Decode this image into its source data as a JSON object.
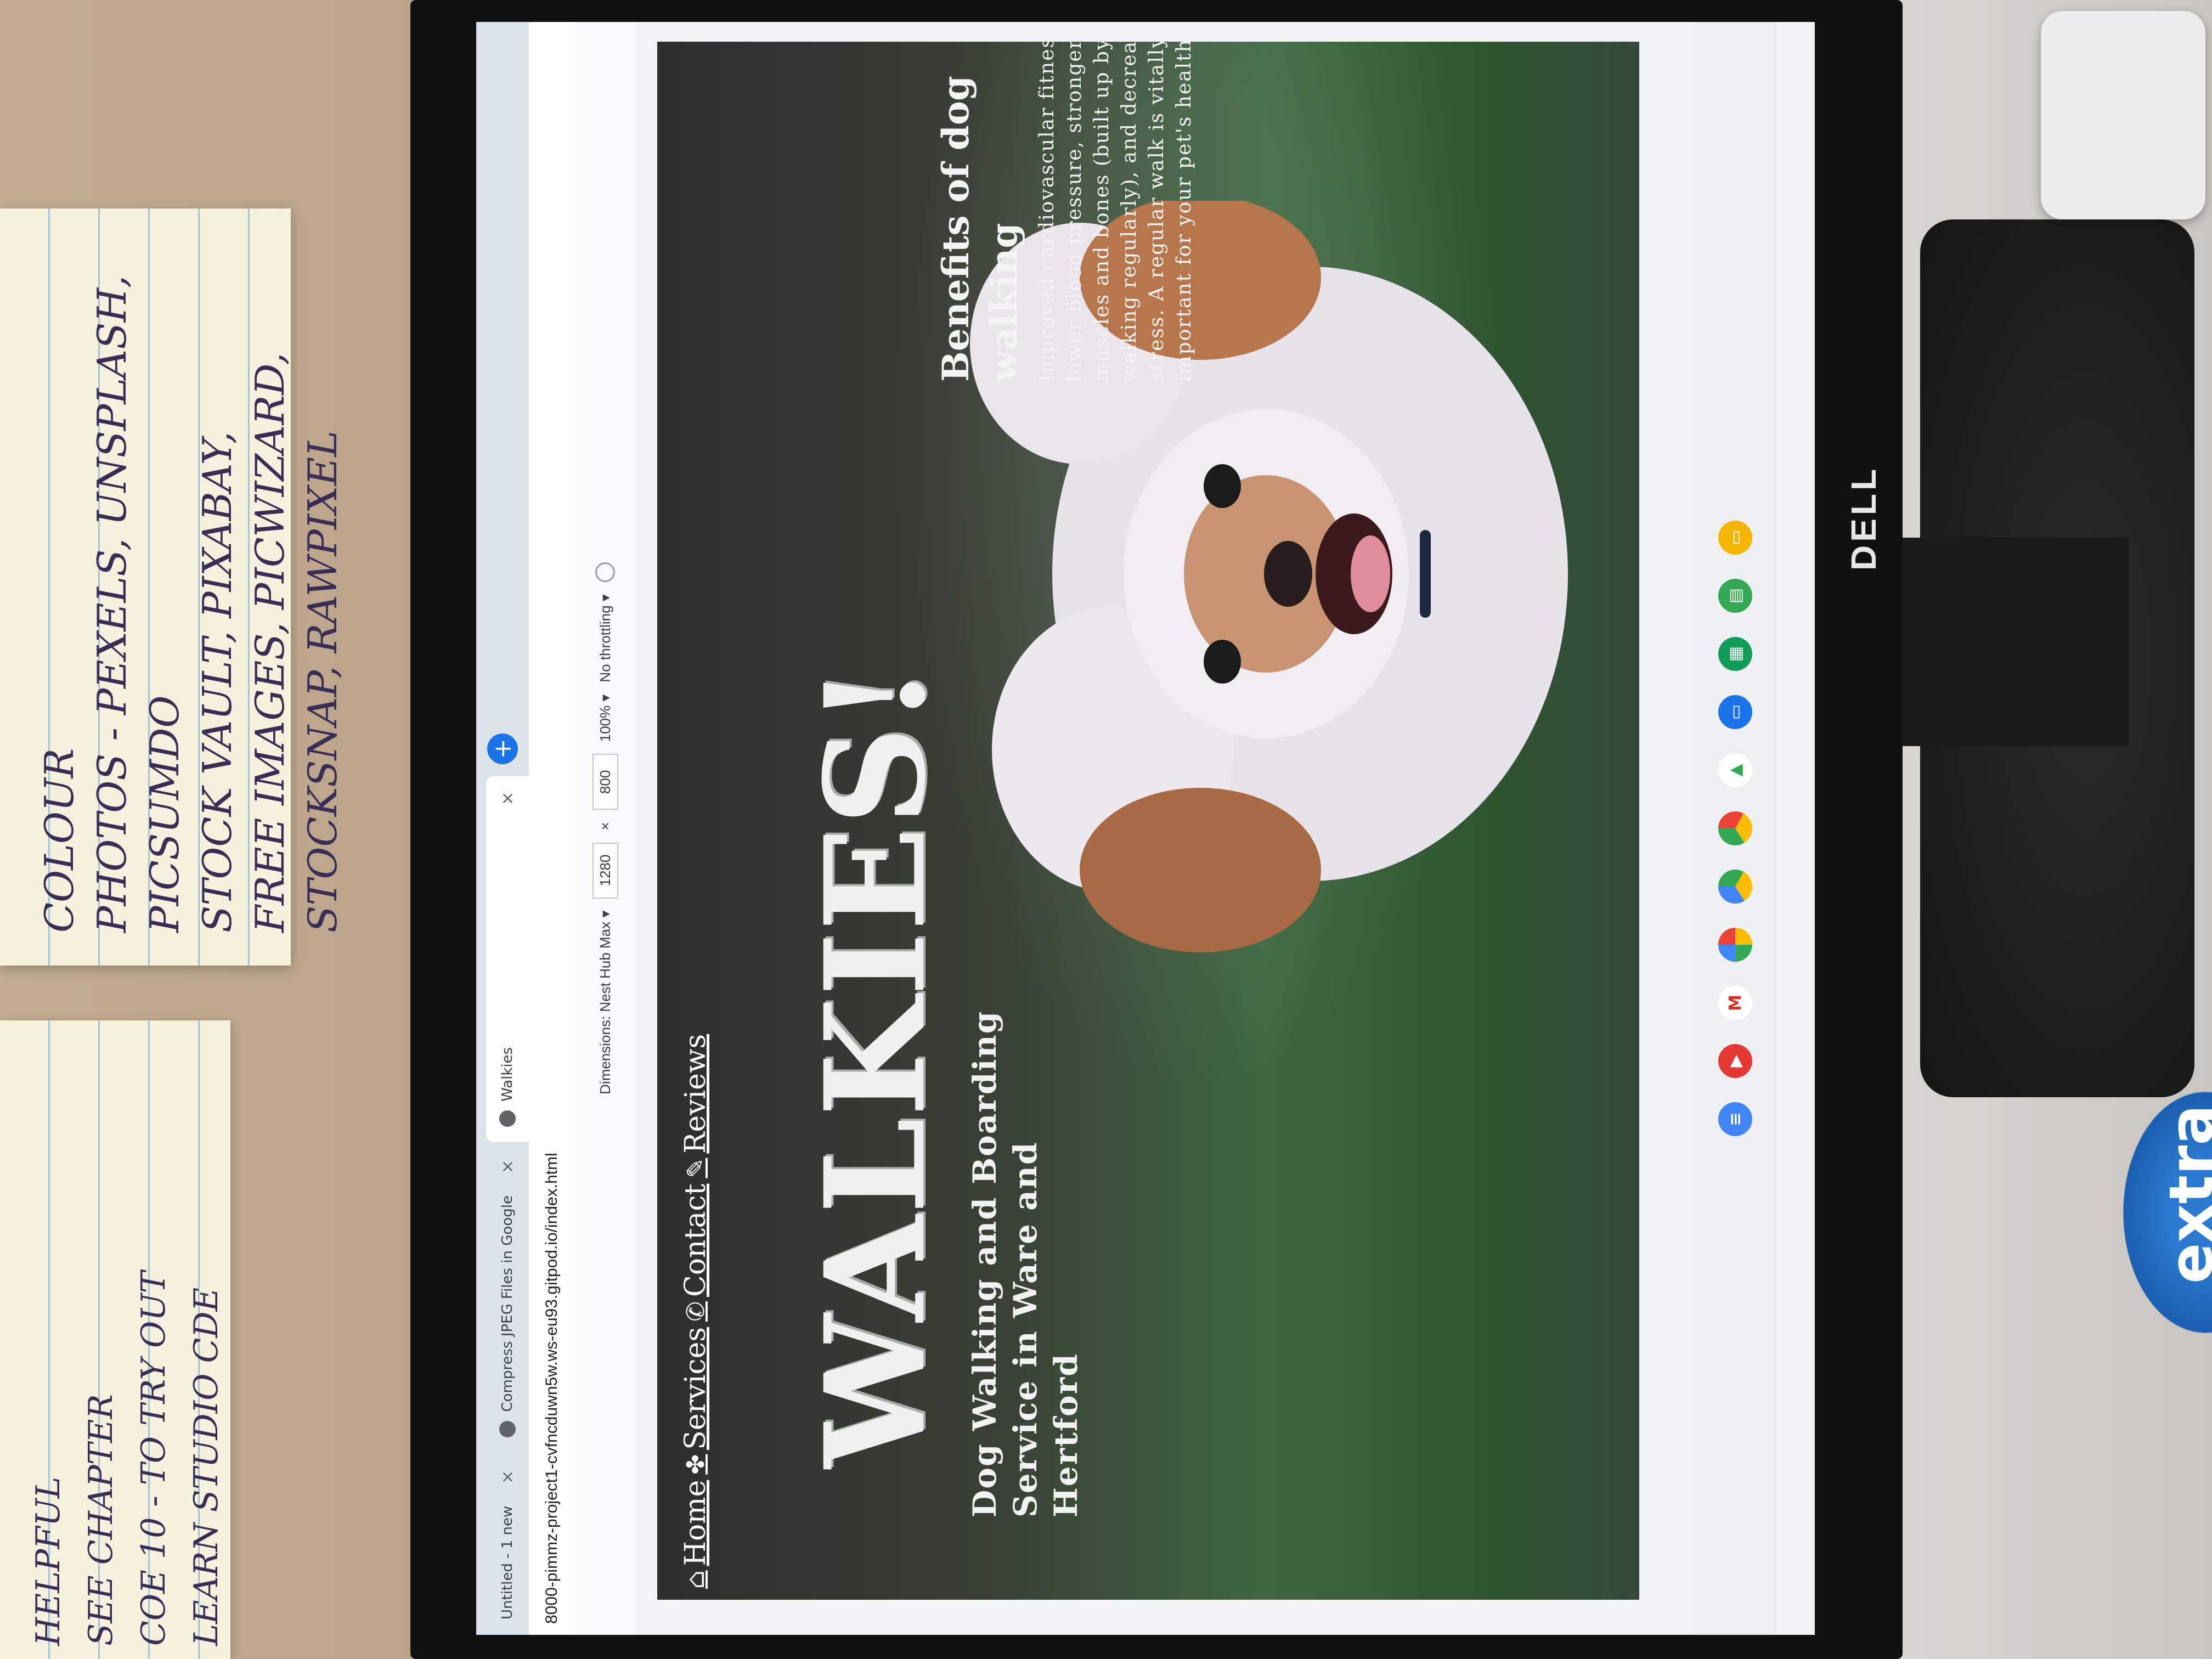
{
  "browser": {
    "tabs": [
      {
        "label": "Untitled - 1 new",
        "active": false
      },
      {
        "label": "Compress JPEG Files in Google",
        "active": false
      },
      {
        "label": "Walkies",
        "active": true
      }
    ],
    "new_tab_symbol": "+",
    "close_symbol": "×",
    "url": "8000-pimmz-project1-cvfncduwn5w.ws-eu93.gitpod.io/index.html"
  },
  "device_toolbar": {
    "dimensions_label": "Dimensions: Nest Hub Max ▾",
    "width": "1280",
    "times": "×",
    "height": "800",
    "zoom": "100% ▾",
    "throttling": "No throttling ▾"
  },
  "site": {
    "nav": [
      {
        "icon": "home-icon",
        "label": "Home"
      },
      {
        "icon": "paw-icon",
        "label": "Services"
      },
      {
        "icon": "phone-icon",
        "label": "Contact"
      },
      {
        "icon": "pencil-icon",
        "label": "Reviews"
      }
    ],
    "title": "WALKIES!",
    "subtitle": "Dog Walking and Boarding Service in Ware and Hertford",
    "benefits_title": "Benefits of dog walking",
    "benefits_body": "Improved cardiovascular fitness, lower blood pressure, stronger muscles and bones (built up by walking regularly), and decreased stress. A regular walk is vitally important for your pet's health."
  },
  "taskbar": [
    "docs-icon",
    "youtube-icon",
    "gmail-icon",
    "photos-icon",
    "drive-icon",
    "chrome-icon",
    "play-store-icon",
    "files-icon",
    "sheets-icon",
    "classroom-icon",
    "slides-icon"
  ],
  "bezel_logo": "DELL",
  "desk": {
    "note1": "COLOUR\nPHOTOS - PEXELS, UNSPLASH, PICSUMDO\nSTOCK VAULT, PIXABAY,\nFREE IMAGES, PICWIZARD,\nSTOCKSNAP, RAWPIXEL",
    "note2": "HELPFUL\nSEE CHAPTER\nCOE 10 - TO TRY OUT\nLEARN STUDIO CDE",
    "gum_label": "extra"
  },
  "colors": {
    "tab_active": "#ffffff",
    "accent_blue": "#1a73e8",
    "hero_text": "#f0f0f0"
  }
}
